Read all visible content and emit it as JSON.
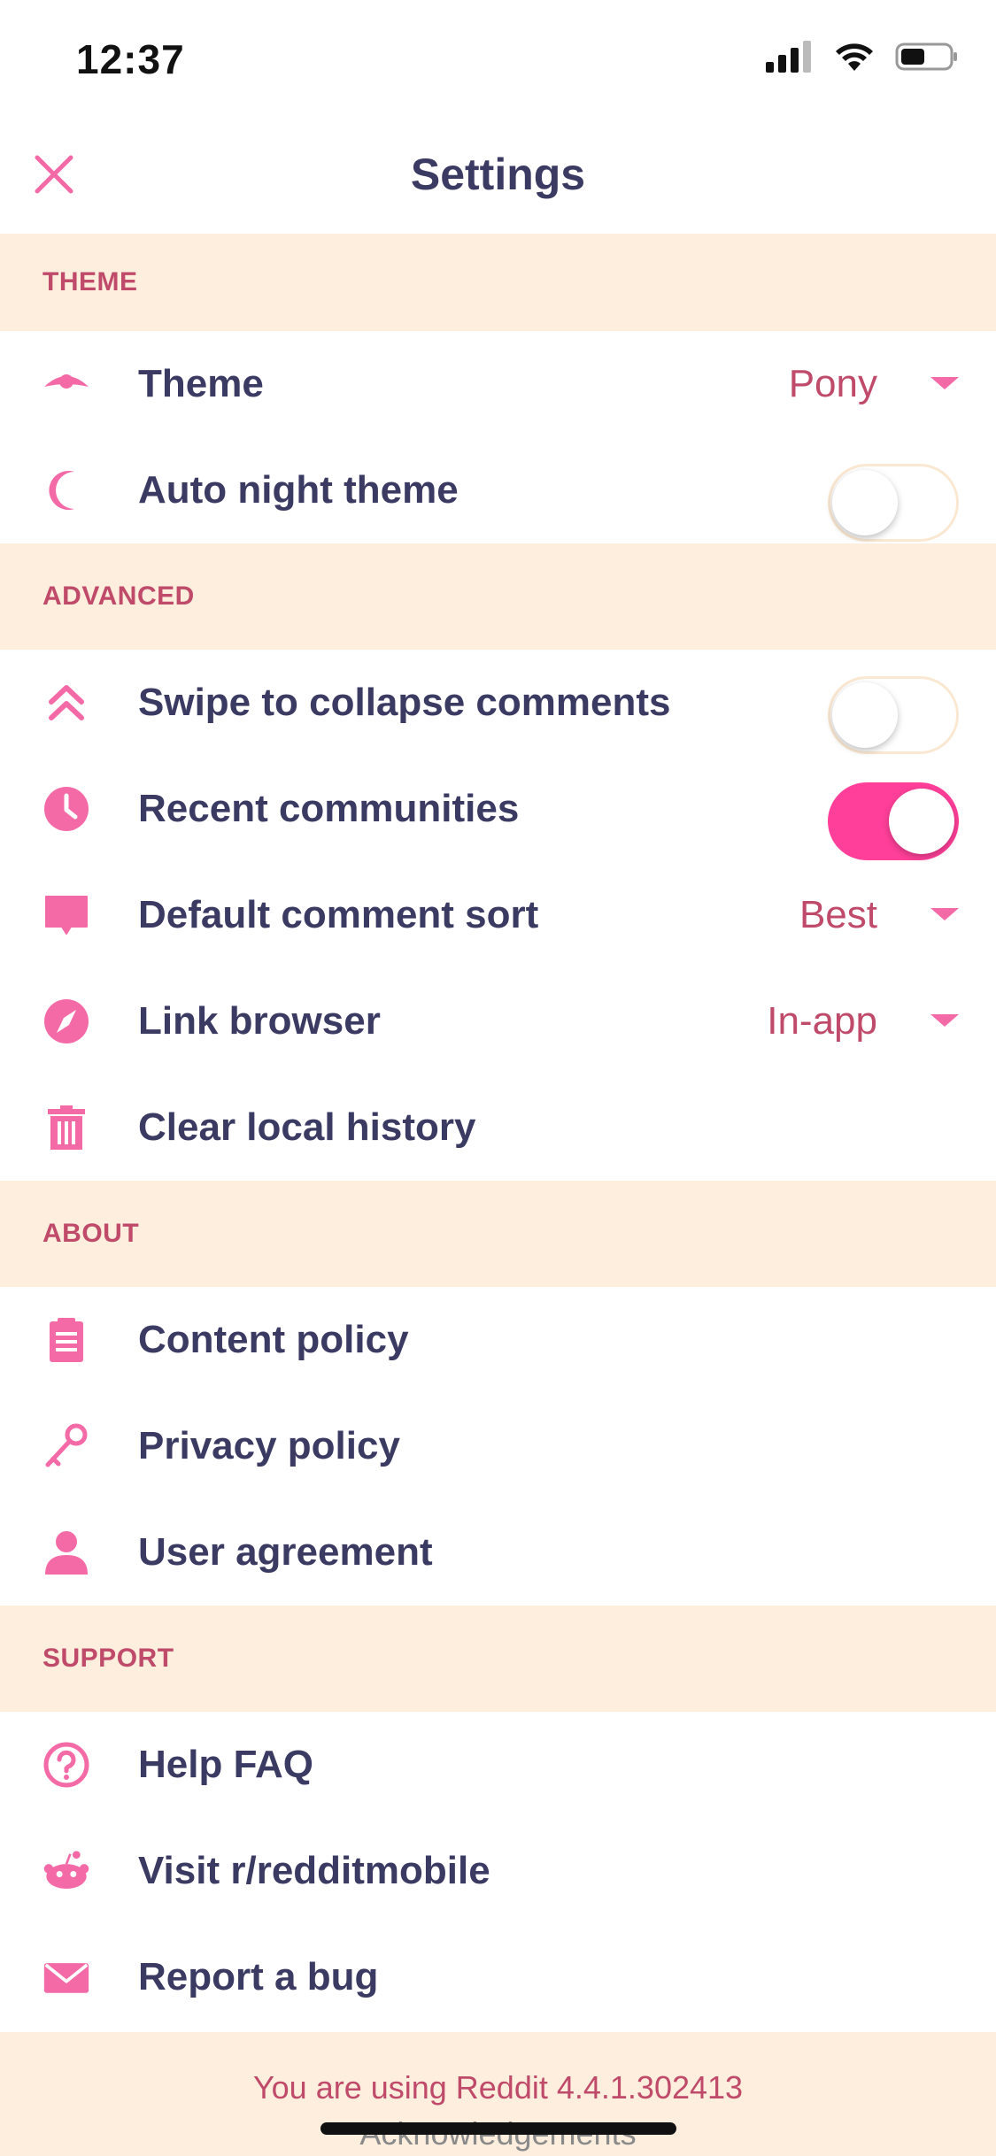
{
  "status_bar": {
    "time": "12:37"
  },
  "header": {
    "title": "Settings"
  },
  "colors": {
    "accent": "#f46aa7",
    "section_bg": "#fdeedd",
    "section_text": "#c04a6a",
    "label": "#3b3a63",
    "toggle_on": "#ff3f99"
  },
  "sections": {
    "theme": {
      "title": "THEME",
      "items": [
        {
          "label": "Theme",
          "value": "Pony",
          "icon": "eye-icon"
        },
        {
          "label": "Auto night theme",
          "toggle": false,
          "icon": "moon-icon"
        }
      ]
    },
    "advanced": {
      "title": "ADVANCED",
      "items": [
        {
          "label": "Swipe to collapse comments",
          "toggle": false,
          "icon": "double-chevron-up-icon"
        },
        {
          "label": "Recent communities",
          "toggle": true,
          "icon": "clock-icon"
        },
        {
          "label": "Default comment sort",
          "value": "Best",
          "icon": "comment-icon"
        },
        {
          "label": "Link browser",
          "value": "In-app",
          "icon": "compass-icon"
        },
        {
          "label": "Clear local history",
          "icon": "trash-icon"
        }
      ]
    },
    "about": {
      "title": "ABOUT",
      "items": [
        {
          "label": "Content policy",
          "icon": "clipboard-icon"
        },
        {
          "label": "Privacy policy",
          "icon": "key-icon"
        },
        {
          "label": "User agreement",
          "icon": "person-icon"
        }
      ]
    },
    "support": {
      "title": "SUPPORT",
      "items": [
        {
          "label": "Help FAQ",
          "icon": "help-icon"
        },
        {
          "label": "Visit r/redditmobile",
          "icon": "reddit-alien-icon"
        },
        {
          "label": "Report a bug",
          "icon": "mail-icon"
        }
      ]
    }
  },
  "footer": {
    "version_text": "You are using Reddit 4.4.1.302413",
    "acknowledgements": "Acknowledgements"
  }
}
